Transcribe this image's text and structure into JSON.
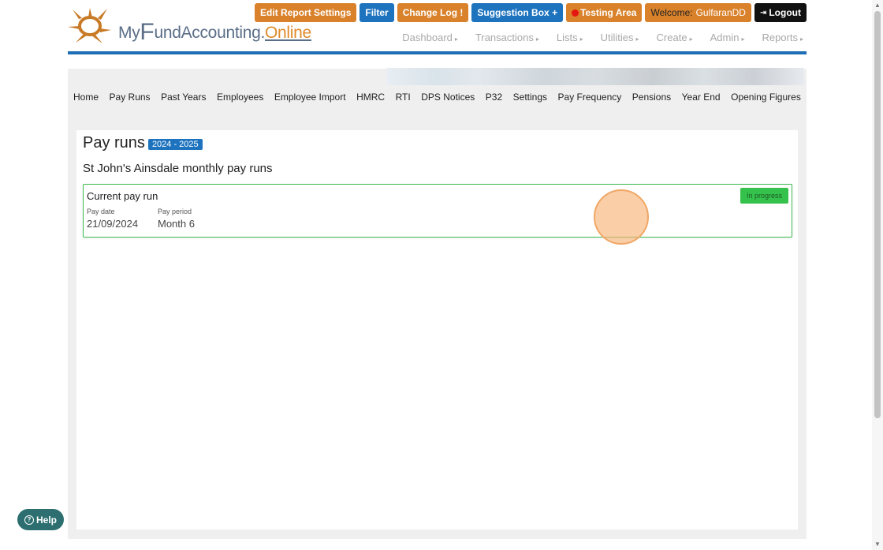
{
  "logo": {
    "my": "My",
    "f": "F",
    "und": "und",
    "accounting": "Accounting.",
    "online": "Online"
  },
  "top_buttons": {
    "edit_report_settings": "Edit Report Settings",
    "filter": "Filter",
    "change_log": "Change Log",
    "change_log_mark": "!",
    "suggestion_box": "Suggestion Box",
    "suggestion_plus": "+",
    "testing_area": "Testing Area",
    "welcome_label": "Welcome:",
    "welcome_user": "GulfaranDD",
    "logout": "Logout"
  },
  "main_nav": [
    "Dashboard",
    "Transactions",
    "Lists",
    "Utilities",
    "Create",
    "Admin",
    "Reports"
  ],
  "sub_nav": [
    "Home",
    "Pay Runs",
    "Past Years",
    "Employees",
    "Employee Import",
    "HMRC",
    "RTI",
    "DPS Notices",
    "P32",
    "Settings",
    "Pay Frequency",
    "Pensions",
    "Year End",
    "Opening Figures"
  ],
  "page": {
    "title": "Pay runs",
    "year_badge": "2024 - 2025",
    "subtitle": "St John's Ainsdale monthly pay runs"
  },
  "current_pay_run": {
    "heading": "Current pay run",
    "status": "In progress",
    "pay_date_label": "Pay date",
    "pay_date": "21/09/2024",
    "pay_period_label": "Pay period",
    "pay_period": "Month 6"
  },
  "help": {
    "label": "Help",
    "icon": "?"
  },
  "colors": {
    "brand_blue": "#1e73be",
    "brand_orange": "#d9822b",
    "status_green": "#35c24c"
  }
}
